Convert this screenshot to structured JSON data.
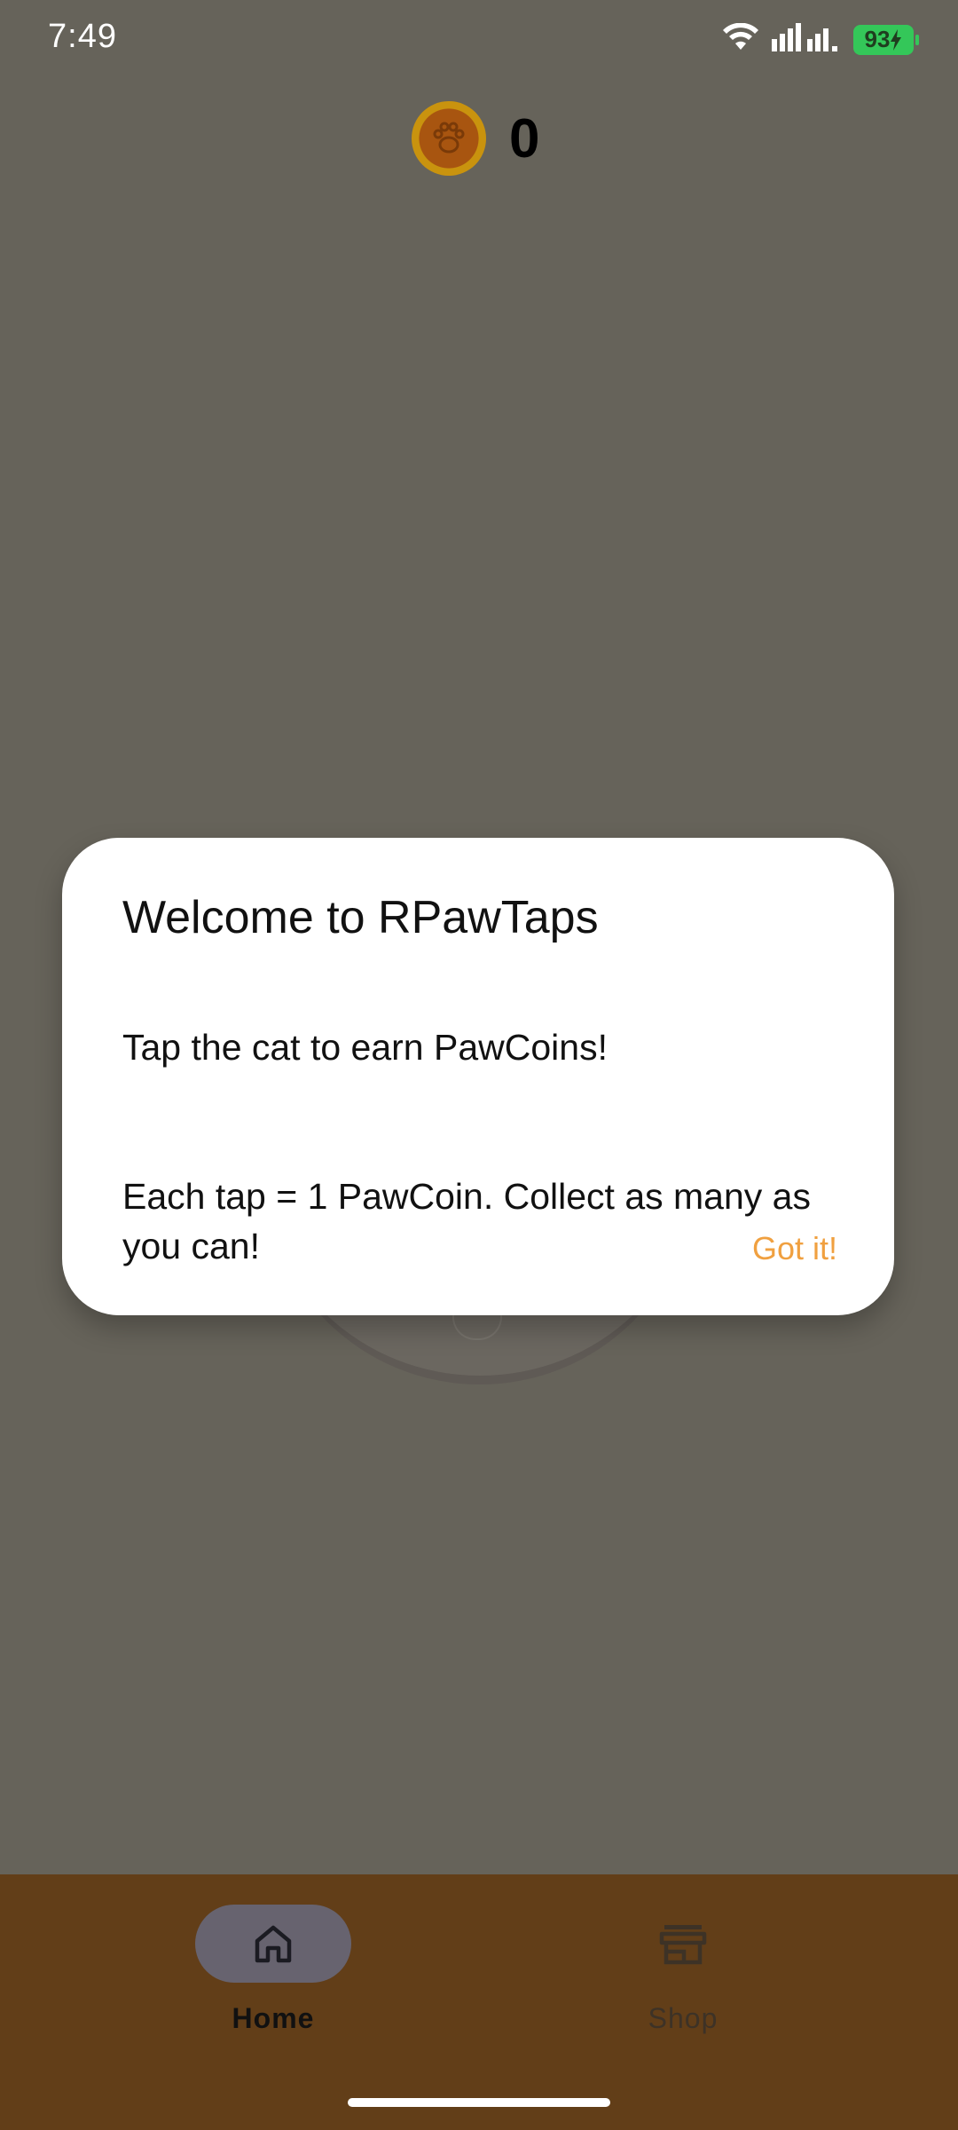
{
  "status_bar": {
    "time": "7:49",
    "battery_level": "93",
    "icons": [
      "wifi-icon",
      "signal-icon",
      "battery-icon",
      "charging-icon"
    ]
  },
  "header": {
    "coin_icon": "pawcoin-icon",
    "coin_count": "0"
  },
  "dialog": {
    "title": "Welcome to RPawTaps",
    "message_line1": "Tap the cat to earn PawCoins!",
    "message_line2": "Each tap = 1 PawCoin. Collect as many as you can!",
    "button_label": "Got it!"
  },
  "bottom_nav": {
    "items": [
      {
        "label": "Home",
        "icon": "home-icon",
        "selected": true
      },
      {
        "label": "Shop",
        "icon": "shop-icon",
        "selected": false
      }
    ]
  },
  "colors": {
    "background_dim": "#66635a",
    "nav_background": "#623e18",
    "accent": "#f0a040",
    "battery": "#34c759"
  }
}
